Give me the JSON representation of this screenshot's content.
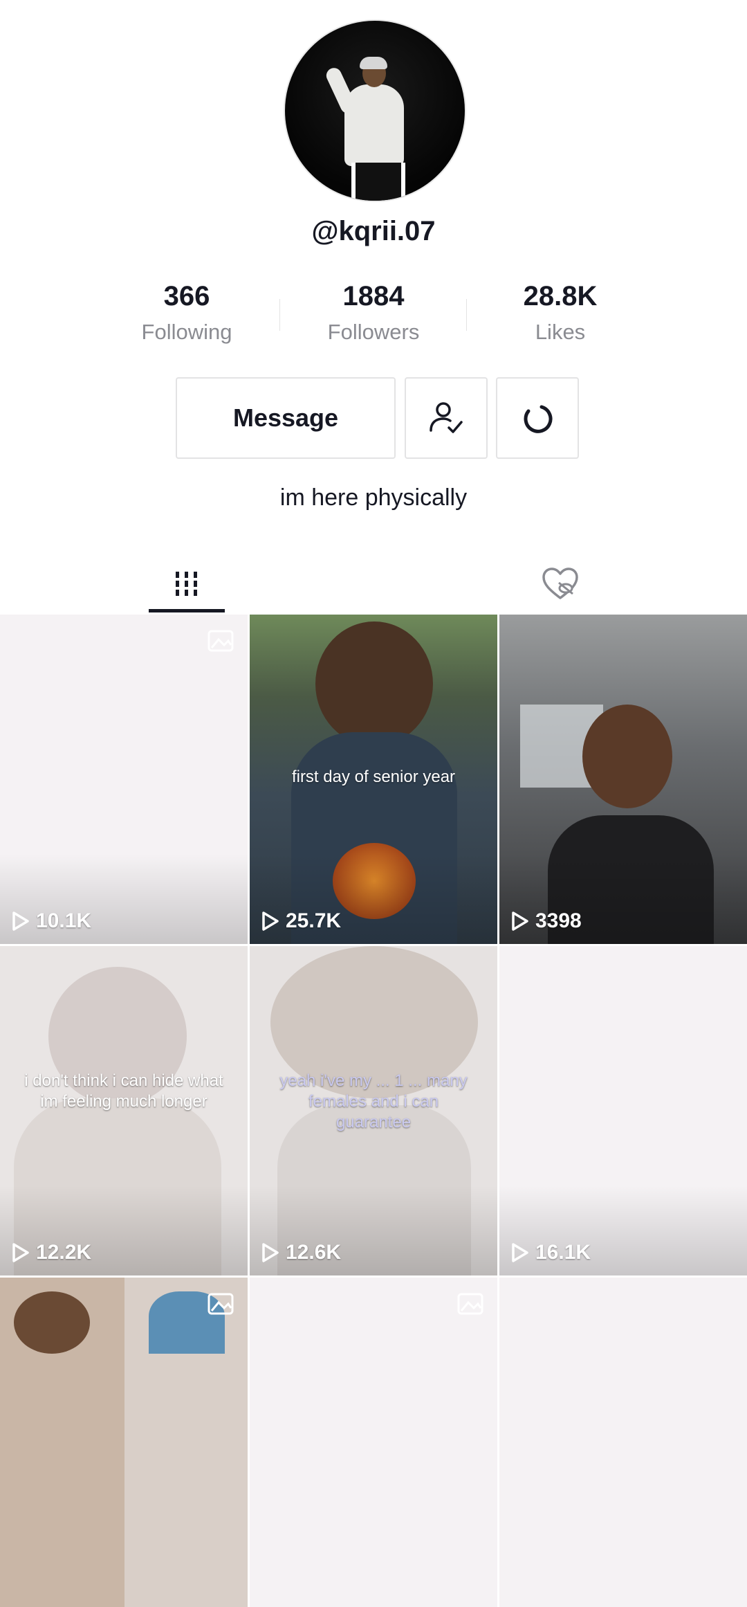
{
  "profile": {
    "username": "@kqrii.07",
    "bio": "im here physically"
  },
  "stats": [
    {
      "value": "366",
      "label": "Following"
    },
    {
      "value": "1884",
      "label": "Followers"
    },
    {
      "value": "28.8K",
      "label": "Likes"
    }
  ],
  "actions": {
    "message_label": "Message",
    "friend_icon": "person-check-icon",
    "share_icon": "refresh-icon"
  },
  "tabs": {
    "videos_icon": "grid-icon",
    "liked_icon": "heart-hidden-icon"
  },
  "videos": [
    {
      "views": "10.1K",
      "caption": ""
    },
    {
      "views": "25.7K",
      "caption": "first day of senior year"
    },
    {
      "views": "3398",
      "caption": ""
    },
    {
      "views": "12.2K",
      "caption": "i don't think i can hide what im feeling much longer"
    },
    {
      "views": "12.6K",
      "caption": "yeah i've my ... 1 ... many females and i can guarantee"
    },
    {
      "views": "16.1K",
      "caption": ""
    }
  ],
  "colors": {
    "text": "#161823",
    "secondary": "#8a8b91",
    "border": "#e3e3e4"
  }
}
